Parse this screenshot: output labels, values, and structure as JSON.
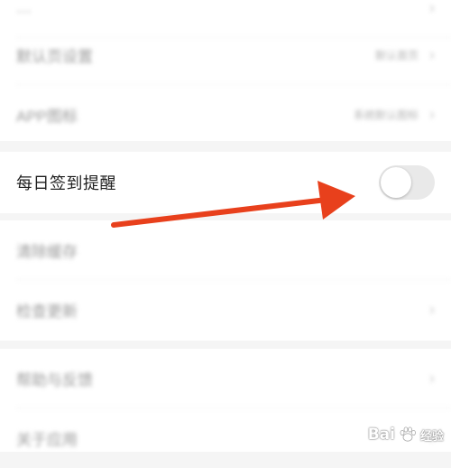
{
  "settings": {
    "rows_top": [
      {
        "label": "…",
        "value": "",
        "blurred": true
      },
      {
        "label": "默认页设置",
        "value": "默认首页",
        "blurred": true
      },
      {
        "label": "APP图标",
        "value": "系统默认图标",
        "blurred": true
      }
    ],
    "daily_checkin": {
      "label": "每日签到提醒",
      "toggle_on": false
    },
    "rows_mid": [
      {
        "label": "清除缓存",
        "value": "",
        "blurred": true
      },
      {
        "label": "检查更新",
        "value": "",
        "blurred": true
      }
    ],
    "rows_bottom": [
      {
        "label": "帮助与反馈",
        "value": "",
        "blurred": true
      },
      {
        "label": "关于应用",
        "value": "",
        "blurred": true
      }
    ]
  },
  "annotation": {
    "type": "arrow",
    "color": "#e8401c",
    "target": "daily-checkin-toggle"
  },
  "watermark": {
    "brand": "Bai",
    "sub": "经验",
    "icon": "paw-icon"
  },
  "colors": {
    "background": "#f5f5f5",
    "row": "#ffffff",
    "toggle_off": "#e9e9e9",
    "arrow": "#e8401c"
  }
}
